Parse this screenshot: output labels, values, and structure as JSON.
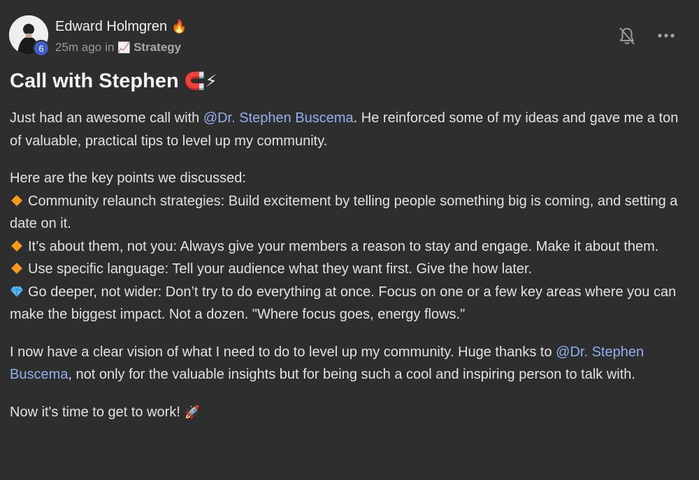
{
  "post": {
    "author": {
      "name": "Edward Holmgren",
      "level": "6",
      "name_emoji": "🔥"
    },
    "meta": {
      "time": "25m ago",
      "in_word": "in",
      "category": "Strategy",
      "category_emoji": "📈"
    },
    "title": {
      "text": "Call with Stephen",
      "emojis": "🧲⚡"
    },
    "body": {
      "p1": {
        "pre": "Just had an awesome call with ",
        "mention": "@Dr. Stephen Buscema",
        "post": ". He reinforced some of my ideas and gave me a ton of valuable, practical tips to level up my community."
      },
      "intro": "Here are the key points we discussed:",
      "bullets": [
        {
          "icon": "orange-diamond-icon",
          "text": "Community relaunch strategies: Build excitement by telling people something big is coming, and setting a date on it."
        },
        {
          "icon": "orange-diamond-icon",
          "text": "It’s about them, not you: Always give your members a reason to stay and engage. Make it about them."
        },
        {
          "icon": "orange-diamond-icon",
          "text": "Use specific language: Tell your audience what they want first. Give the how later."
        },
        {
          "icon": "gem-icon",
          "text": "Go deeper, not wider: Don’t try to do everything at once. Focus on one or a few key areas where you can make the biggest impact. Not a dozen. \"Where focus goes, energy flows.\""
        }
      ],
      "p3": {
        "pre": "I now have a clear vision of what I need to do to level up my community. Huge thanks to ",
        "mention": "@Dr. Stephen Buscema",
        "post": ", not only for the valuable insights but for being such a cool and inspiring person to talk with."
      },
      "p4": {
        "text": "Now it's time to get to work!",
        "emoji": "🚀"
      }
    }
  },
  "colors": {
    "background": "#2e2e2e",
    "mention": "#8fb0ee",
    "level_badge": "#3f5fc8",
    "orange_diamond": "#f39a1c",
    "gem": "#59b6f5"
  }
}
